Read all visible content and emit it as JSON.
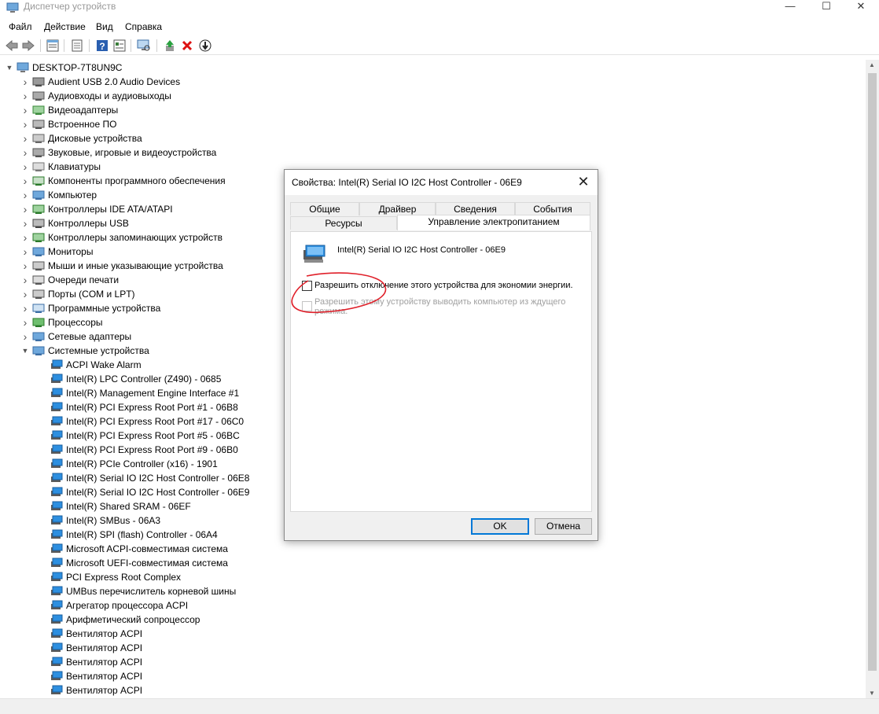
{
  "window": {
    "title": "Диспетчер устройств",
    "controls": {
      "minimize": "—",
      "maximize": "☐",
      "close": "✕"
    }
  },
  "menu": [
    "Файл",
    "Действие",
    "Вид",
    "Справка"
  ],
  "toolbar": [
    "back-icon",
    "forward-icon",
    "properties-icon",
    "view-icon",
    "help-icon",
    "details-icon",
    "scan-icon",
    "update-driver-icon",
    "uninstall-icon",
    "disable-icon"
  ],
  "tree": {
    "root": "DESKTOP-7T8UN9C",
    "categories": [
      {
        "label": "Audient USB 2.0 Audio Devices",
        "icon": "audio-device-icon"
      },
      {
        "label": "Аудиовходы и аудиовыходы",
        "icon": "speaker-icon"
      },
      {
        "label": "Видеоадаптеры",
        "icon": "display-adapter-icon"
      },
      {
        "label": "Встроенное ПО",
        "icon": "firmware-icon"
      },
      {
        "label": "Дисковые устройства",
        "icon": "disk-icon"
      },
      {
        "label": "Звуковые, игровые и видеоустройства",
        "icon": "sound-icon"
      },
      {
        "label": "Клавиатуры",
        "icon": "keyboard-icon"
      },
      {
        "label": "Компоненты программного обеспечения",
        "icon": "software-component-icon"
      },
      {
        "label": "Компьютер",
        "icon": "computer-icon"
      },
      {
        "label": "Контроллеры IDE ATA/ATAPI",
        "icon": "ide-controller-icon"
      },
      {
        "label": "Контроллеры USB",
        "icon": "usb-icon"
      },
      {
        "label": "Контроллеры запоминающих устройств",
        "icon": "storage-controller-icon"
      },
      {
        "label": "Мониторы",
        "icon": "monitor-icon"
      },
      {
        "label": "Мыши и иные указывающие устройства",
        "icon": "mouse-icon"
      },
      {
        "label": "Очереди печати",
        "icon": "printer-icon"
      },
      {
        "label": "Порты (COM и LPT)",
        "icon": "port-icon"
      },
      {
        "label": "Программные устройства",
        "icon": "software-device-icon"
      },
      {
        "label": "Процессоры",
        "icon": "processor-icon"
      },
      {
        "label": "Сетевые адаптеры",
        "icon": "network-adapter-icon"
      },
      {
        "label": "Системные устройства",
        "icon": "system-devices-icon",
        "expanded": true
      }
    ],
    "system_devices": [
      "ACPI Wake Alarm",
      "Intel(R) LPC Controller (Z490) - 0685",
      "Intel(R) Management Engine Interface #1",
      "Intel(R) PCI Express Root Port #1 - 06B8",
      "Intel(R) PCI Express Root Port #17 - 06C0",
      "Intel(R) PCI Express Root Port #5 - 06BC",
      "Intel(R) PCI Express Root Port #9 - 06B0",
      "Intel(R) PCIe Controller (x16) - 1901",
      "Intel(R) Serial IO I2C Host Controller - 06E8",
      "Intel(R) Serial IO I2C Host Controller - 06E9",
      "Intel(R) Shared SRAM - 06EF",
      "Intel(R) SMBus - 06A3",
      "Intel(R) SPI (flash) Controller - 06A4",
      "Microsoft ACPI-совместимая система",
      "Microsoft UEFI-совместимая система",
      "PCI Express Root Complex",
      "UMBus перечислитель корневой шины",
      "Агрегатор процессора ACPI",
      "Арифметический сопроцессор",
      "Вентилятор ACPI",
      "Вентилятор ACPI",
      "Вентилятор ACPI",
      "Вентилятор ACPI",
      "Вентилятор ACPI"
    ]
  },
  "dialog": {
    "title": "Свойства: Intel(R) Serial IO I2C Host Controller - 06E9",
    "tabs_row1": [
      "Общие",
      "Драйвер",
      "Сведения",
      "События"
    ],
    "tabs_row2": [
      "Ресурсы",
      "Управление электропитанием"
    ],
    "active_tab": "Управление электропитанием",
    "device_name": "Intel(R) Serial IO I2C Host Controller - 06E9",
    "checkbox1": "Разрешить отключение этого устройства для экономии энергии.",
    "checkbox1_checked": false,
    "checkbox2_line1": "Разрешить этому устройству выводить компьютер из ждущего",
    "checkbox2_line2": "режима.",
    "checkbox2_enabled": false,
    "ok": "OK",
    "cancel": "Отмена"
  },
  "colors": {
    "accent": "#0078d7",
    "annotation": "#e0202a"
  }
}
